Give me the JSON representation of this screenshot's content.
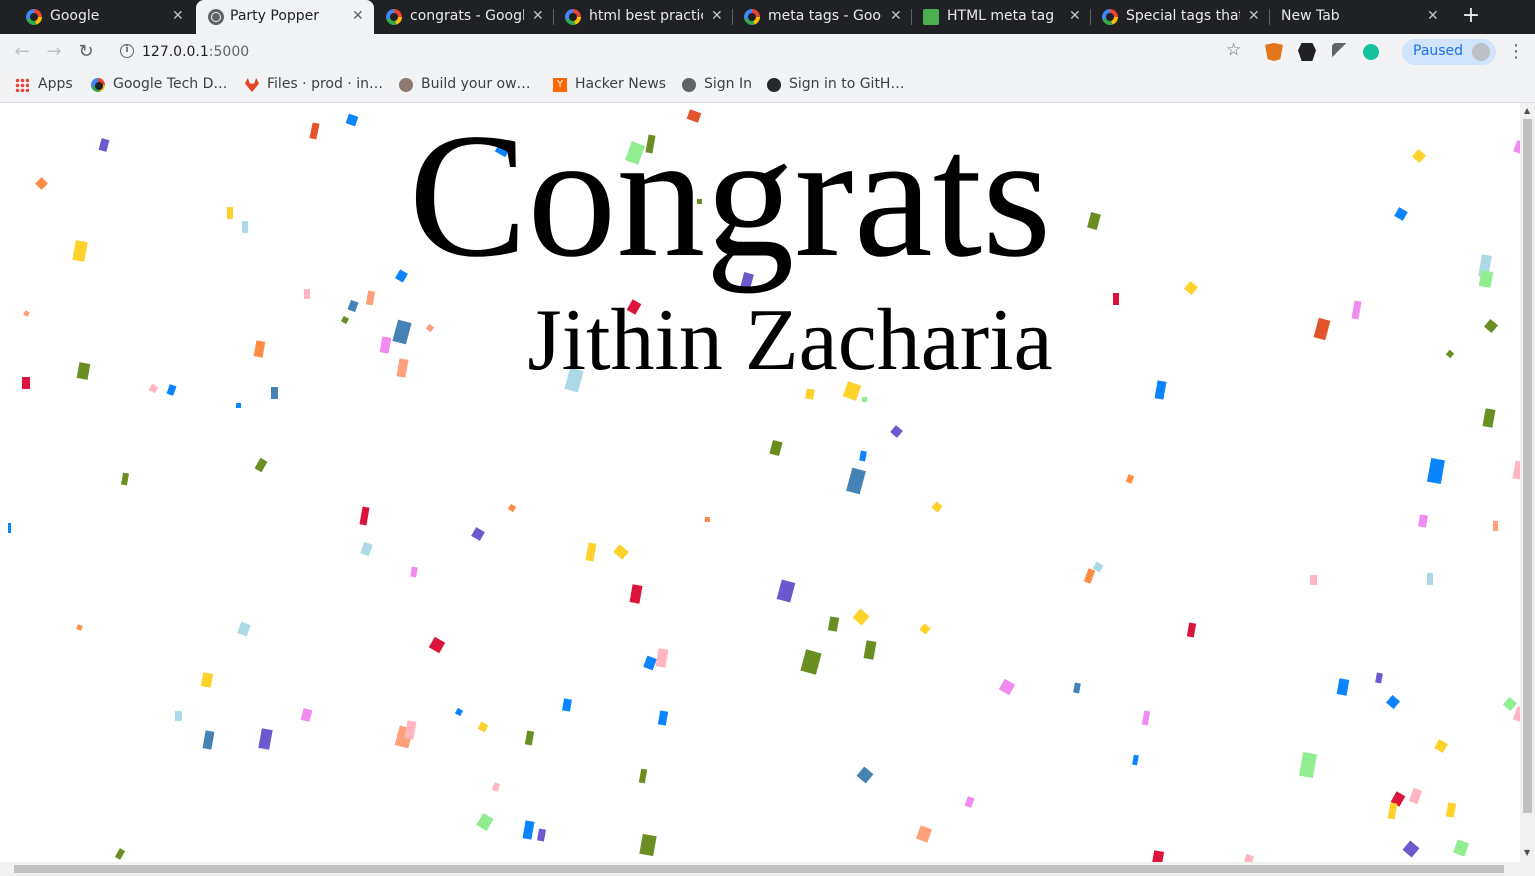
{
  "tabs": [
    {
      "title": "Google",
      "icon": "google-icon",
      "active": false
    },
    {
      "title": "Party Popper",
      "icon": "globe-icon",
      "active": true
    },
    {
      "title": "congrats - Googl",
      "icon": "google-icon",
      "active": false
    },
    {
      "title": "html best practic",
      "icon": "google-icon",
      "active": false
    },
    {
      "title": "meta tags - Goog",
      "icon": "google-icon",
      "active": false
    },
    {
      "title": "HTML meta tag",
      "icon": "w3schools-icon",
      "active": false
    },
    {
      "title": "Special tags that",
      "icon": "google-icon",
      "active": false
    },
    {
      "title": "New Tab",
      "icon": "",
      "active": false
    }
  ],
  "close_glyph": "✕",
  "new_tab_glyph": "+",
  "address": {
    "host": "127.0.0.1",
    "port": ":5000"
  },
  "profile_label": "Paused",
  "bookmarks": [
    {
      "label": "Apps",
      "icon": "apps-grid-icon"
    },
    {
      "label": "Google Tech D…",
      "icon": "google-icon"
    },
    {
      "label": "Files · prod · in…",
      "icon": "gitlab-icon"
    },
    {
      "label": "Build your ow…",
      "icon": "avatar-icon"
    },
    {
      "label": "Hacker News",
      "icon": "hacker-news-icon"
    },
    {
      "label": "Sign In",
      "icon": "globe-icon"
    },
    {
      "label": "Sign in to GitH…",
      "icon": "github-icon"
    }
  ],
  "page": {
    "title": "Congrats",
    "name": "Jithin Zacharia"
  },
  "confetti_colors": [
    "#e2542a",
    "#0a84ff",
    "#6a5acd",
    "#ffd12b",
    "#90ee90",
    "#f08cf0",
    "#6b8e23",
    "#add8e6",
    "#ffa07a",
    "#ffb6c1",
    "#dc143c",
    "#4682b4",
    "#ff8c42"
  ]
}
